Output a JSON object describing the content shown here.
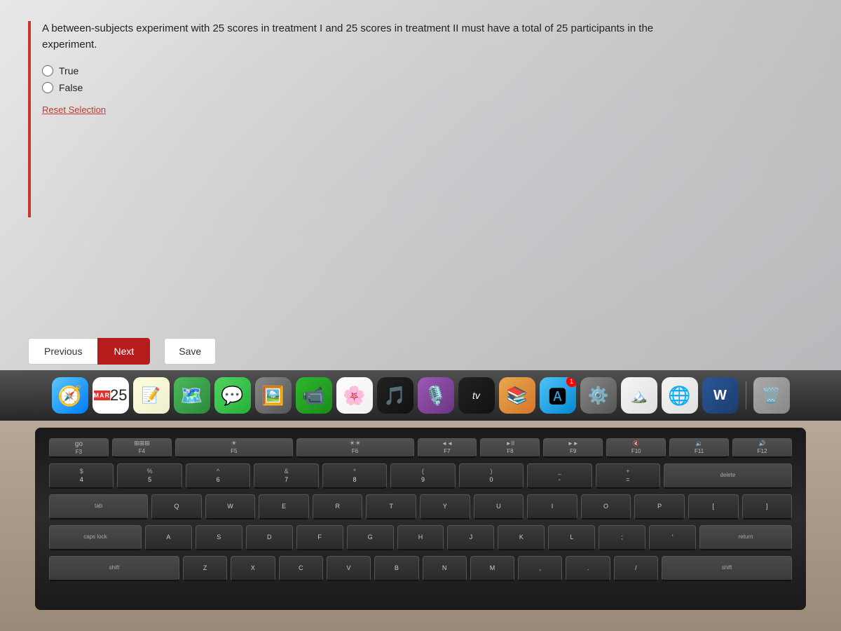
{
  "screen": {
    "background": "#d4d0cc"
  },
  "question": {
    "text": "A between-subjects experiment with 25 scores in treatment I and 25 scores in treatment II must have a total of 25 participants in the experiment.",
    "options": [
      {
        "label": "True",
        "value": "true"
      },
      {
        "label": "False",
        "value": "false"
      }
    ],
    "reset_label": "Reset Selection"
  },
  "buttons": {
    "previous": "Previous",
    "next": "Next",
    "save": "Save"
  },
  "dock": {
    "calendar_month": "MAR",
    "calendar_day": "25",
    "tv_label": "tv"
  },
  "keyboard": {
    "fn_row": [
      "go F3",
      "ooo F4",
      "F5",
      "F6",
      "◄◄ F7",
      "►II F8",
      "►► F9",
      "F10",
      "F11",
      "F12"
    ],
    "num_row": [
      "$4",
      "%5",
      "^6",
      "&7",
      "*8",
      "(9",
      ")0",
      "--",
      "=+"
    ],
    "alpha_row1": [],
    "alpha_row2": []
  }
}
